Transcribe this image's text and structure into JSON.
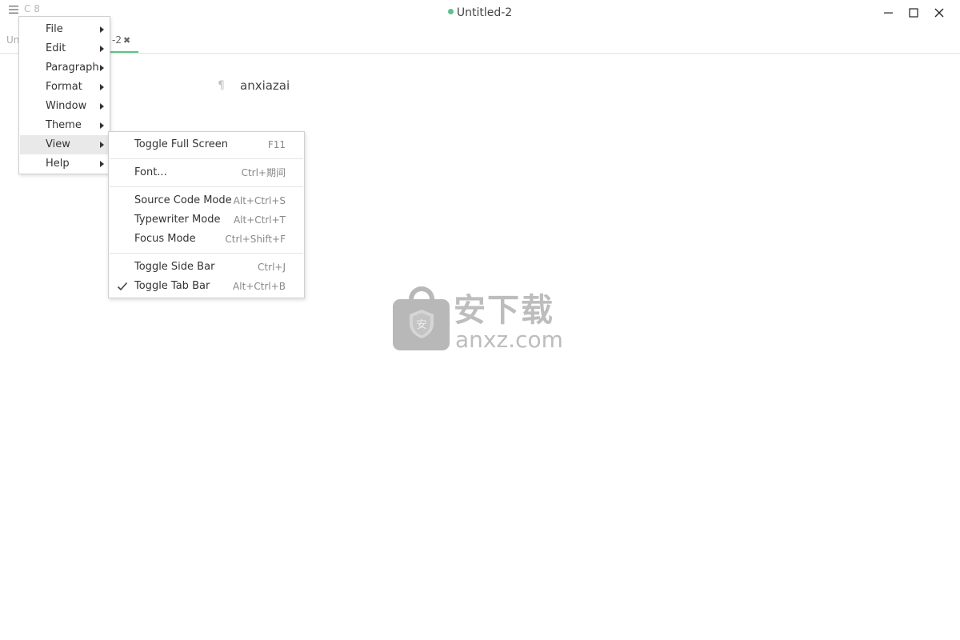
{
  "titlebar": {
    "app_tag": "C 8",
    "window_title": "Untitled-2",
    "status_color": "#5ec189"
  },
  "tabs": {
    "tab1_label": "Un",
    "tab2_label": "-2",
    "tab2_close": "✖",
    "active_color": "#5ec189"
  },
  "editor": {
    "pilcrow": "¶",
    "text": "anxiazai"
  },
  "watermark": {
    "cn": "安下载",
    "en": "anxz.com",
    "shield_glyph": "安"
  },
  "main_menu": {
    "items": [
      {
        "label": "File"
      },
      {
        "label": "Edit"
      },
      {
        "label": "Paragraph"
      },
      {
        "label": "Format"
      },
      {
        "label": "Window"
      },
      {
        "label": "Theme"
      },
      {
        "label": "View"
      },
      {
        "label": "Help"
      }
    ]
  },
  "view_menu": {
    "items": [
      {
        "label": "Toggle Full Screen",
        "shortcut": "F11"
      },
      {
        "label": "Font...",
        "shortcut": "Ctrl+期间"
      },
      {
        "label": "Source Code Mode",
        "shortcut": "Alt+Ctrl+S"
      },
      {
        "label": "Typewriter Mode",
        "shortcut": "Alt+Ctrl+T"
      },
      {
        "label": "Focus Mode",
        "shortcut": "Ctrl+Shift+F"
      },
      {
        "label": "Toggle Side Bar",
        "shortcut": "Ctrl+J"
      },
      {
        "label": "Toggle Tab Bar",
        "shortcut": "Alt+Ctrl+B",
        "checked": true
      }
    ]
  }
}
